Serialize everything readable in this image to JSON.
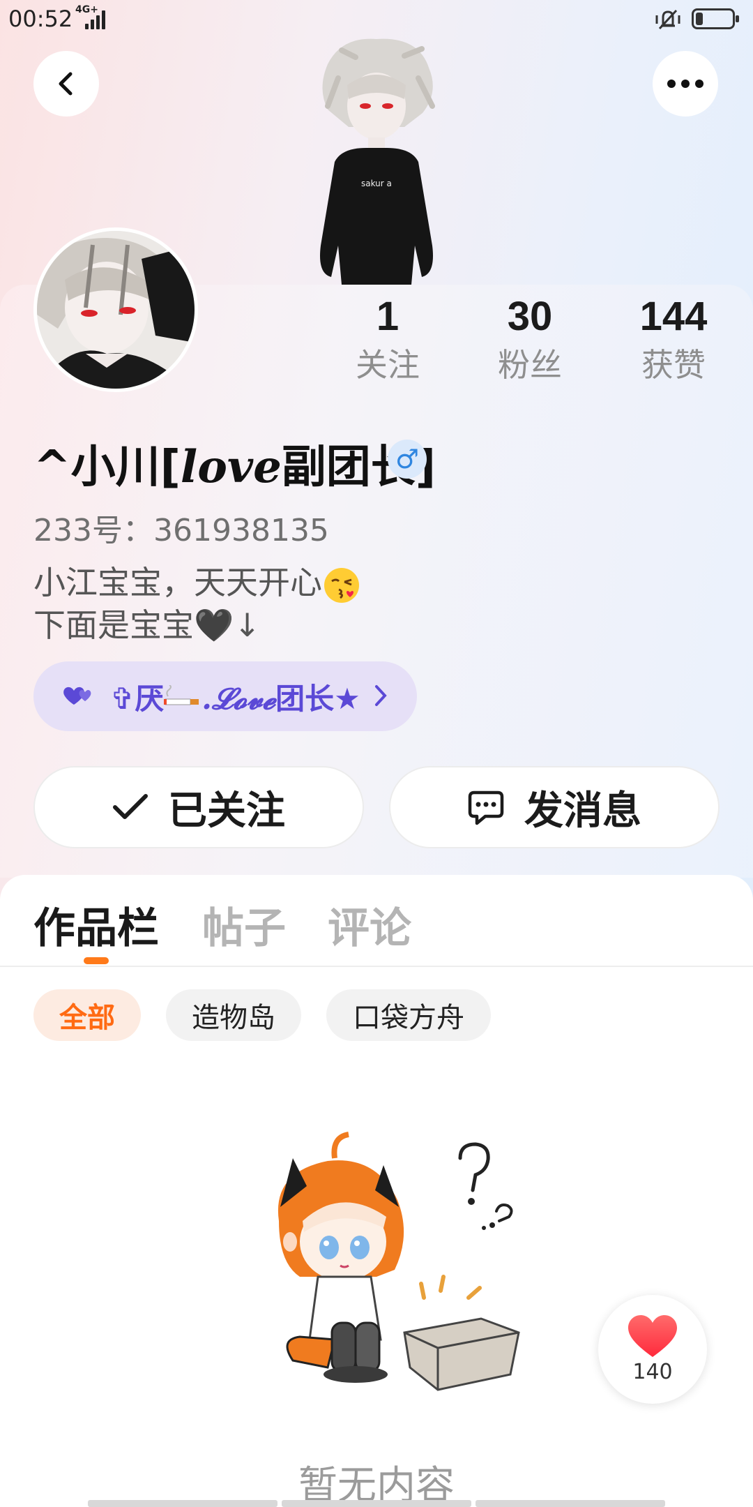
{
  "status_bar": {
    "time": "00:52",
    "network": "4G+",
    "battery_level": 0.15
  },
  "header": {
    "back_icon": "chevron-left-icon",
    "more_icon": "more-horizontal-icon"
  },
  "profile": {
    "stats": [
      {
        "value": "1",
        "label": "关注"
      },
      {
        "value": "30",
        "label": "粉丝"
      },
      {
        "value": "144",
        "label": "获赞"
      }
    ],
    "username_prefix": "^小川[",
    "username_love": "love",
    "username_suffix": "副团长]",
    "gender_symbol": "♂",
    "uid": "233号：361938135",
    "bio_line1": "小江宝宝，天天开心",
    "bio_line2": "下面是宝宝🖤↓",
    "club": {
      "prefix": "✞厌",
      "script": ".𝓛𝓸𝓿𝓮",
      "suffix": "团长★",
      "color": "#5b49d6"
    }
  },
  "actions": {
    "follow_label": "已关注",
    "message_label": "发消息"
  },
  "tabs": [
    {
      "label": "作品栏",
      "active": true
    },
    {
      "label": "帖子",
      "active": false
    },
    {
      "label": "评论",
      "active": false
    }
  ],
  "filters": [
    {
      "label": "全部",
      "active": true
    },
    {
      "label": "造物岛",
      "active": false
    },
    {
      "label": "口袋方舟",
      "active": false
    }
  ],
  "empty_state": {
    "text": "暂无内容"
  },
  "like_button": {
    "count": "140"
  },
  "colors": {
    "accent": "#ff6a13",
    "club_purple": "#5b49d6",
    "gender_blue": "#2f86e0",
    "like_red": "#ff3b47"
  }
}
